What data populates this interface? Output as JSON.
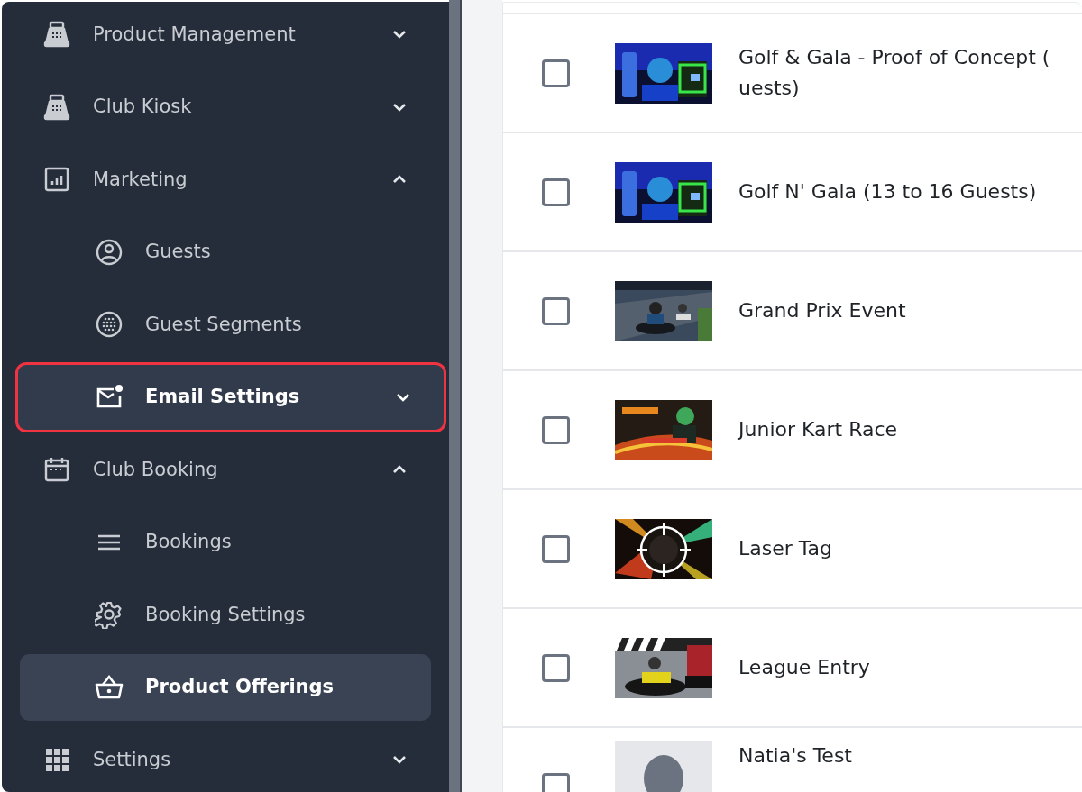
{
  "sidebar": {
    "items": [
      {
        "label": "Product Management",
        "expanded": false,
        "selected": false,
        "highlighted": false
      },
      {
        "label": "Club Kiosk",
        "expanded": false,
        "selected": false,
        "highlighted": false
      },
      {
        "label": "Marketing",
        "expanded": true,
        "selected": false,
        "highlighted": false,
        "children": [
          {
            "label": "Guests",
            "selected": false,
            "highlighted": false
          },
          {
            "label": "Guest Segments",
            "selected": false,
            "highlighted": false
          },
          {
            "label": "Email Settings",
            "expanded": false,
            "selected": false,
            "highlighted": true
          }
        ]
      },
      {
        "label": "Club Booking",
        "expanded": true,
        "selected": false,
        "highlighted": false,
        "children": [
          {
            "label": "Bookings",
            "selected": false,
            "highlighted": false
          },
          {
            "label": "Booking Settings",
            "selected": false,
            "highlighted": false
          },
          {
            "label": "Product Offerings",
            "selected": true,
            "highlighted": false
          }
        ]
      },
      {
        "label": "Settings",
        "expanded": false,
        "selected": false,
        "highlighted": false
      }
    ]
  },
  "products": {
    "rows": [
      {
        "name": "Golf & Gala - Proof of Concept (",
        "name_continued": "uests)",
        "checked": false
      },
      {
        "name": "Golf N' Gala (13 to 16 Guests)",
        "checked": false
      },
      {
        "name": "Grand Prix Event",
        "checked": false
      },
      {
        "name": "Junior Kart Race",
        "checked": false
      },
      {
        "name": "Laser Tag",
        "checked": false
      },
      {
        "name": "League Entry",
        "checked": false
      },
      {
        "name": "Natia's Test",
        "checked": false
      }
    ]
  }
}
